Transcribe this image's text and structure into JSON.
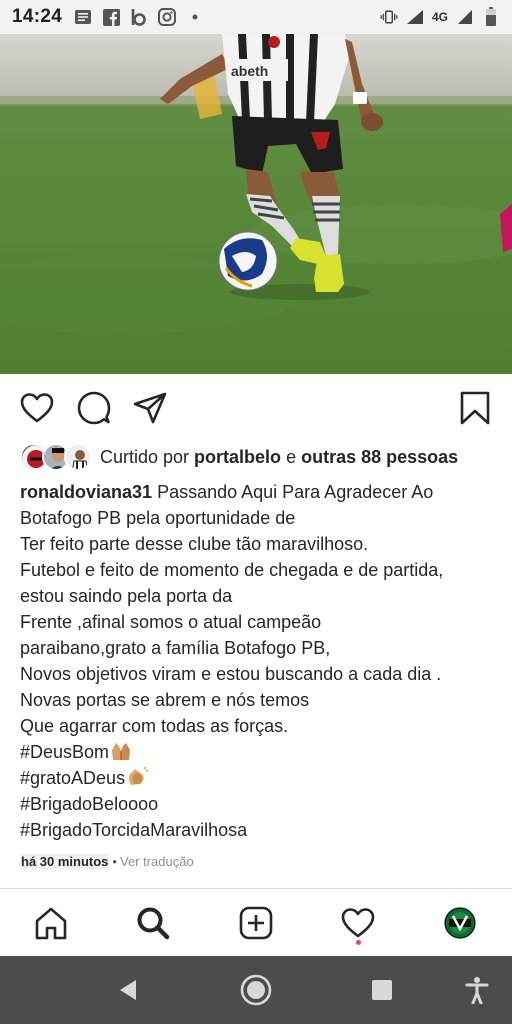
{
  "status_bar": {
    "time": "14:24",
    "network_label": "4G",
    "notification_icons": [
      "message-icon",
      "facebook-icon",
      "b-app-icon",
      "instagram-icon",
      "more-dot-icon"
    ],
    "system_icons": [
      "vibrate-icon",
      "signal-icon",
      "battery-icon"
    ]
  },
  "post": {
    "photo_description_icon": "soccer-photo",
    "actions": [
      "like-heart-icon",
      "comment-icon",
      "share-icon",
      "save-bookmark-icon"
    ],
    "likes": {
      "prefix": "Curtido por ",
      "user": "portalbelo",
      "connector": " e ",
      "others": "outras 88 pessoas"
    },
    "caption": {
      "username": "ronaldoviana31",
      "lines": [
        "Passando Aqui Para Agradecer Ao",
        "Botafogo PB pela oportunidade de",
        "Ter feito parte desse clube tão maravilhoso.",
        "Futebol e feito de momento de chegada e de partida,",
        "estou saindo pela porta da",
        "Frente ,afinal somos o atual campeão",
        "paraibano,grato a família Botafogo PB,",
        "Novos objetivos viram e estou buscando a cada dia .",
        "Novas portas se abrem e nós temos",
        "Que agarrar com todas as forças.",
        "#DeusBom",
        "#gratoADeus",
        "#BrigadoBeloooo",
        "#BrigadoTorcidaMaravilhosa"
      ]
    },
    "time_ago": "há 30 minutos",
    "separator": "•",
    "translate_link": "Ver tradução"
  },
  "tab_bar": [
    "home-icon",
    "search-icon",
    "new-post-icon",
    "activity-heart-icon",
    "profile-avatar"
  ],
  "nav_bar": [
    "back-icon",
    "home-circle-icon",
    "recents-icon",
    "accessibility-icon"
  ],
  "colors": {
    "notification_dot": "#ed4956",
    "nav_bar": "#4a4c50",
    "text": "#262626",
    "muted": "#8e8e8e"
  }
}
